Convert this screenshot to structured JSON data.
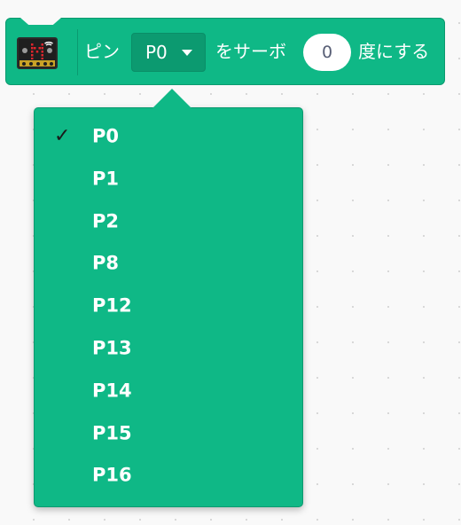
{
  "block": {
    "icon": "microbit-board-icon",
    "pin_label": "ピン",
    "pin_value": "P0",
    "servo_label": "をサーボ",
    "angle_value": "0",
    "degree_label": "度にする",
    "color": "#0fb886"
  },
  "dropdown": {
    "selected": "P0",
    "check_mark": "✓",
    "items": [
      {
        "label": "P0"
      },
      {
        "label": "P1"
      },
      {
        "label": "P2"
      },
      {
        "label": "P8"
      },
      {
        "label": "P12"
      },
      {
        "label": "P13"
      },
      {
        "label": "P14"
      },
      {
        "label": "P15"
      },
      {
        "label": "P16"
      }
    ]
  }
}
